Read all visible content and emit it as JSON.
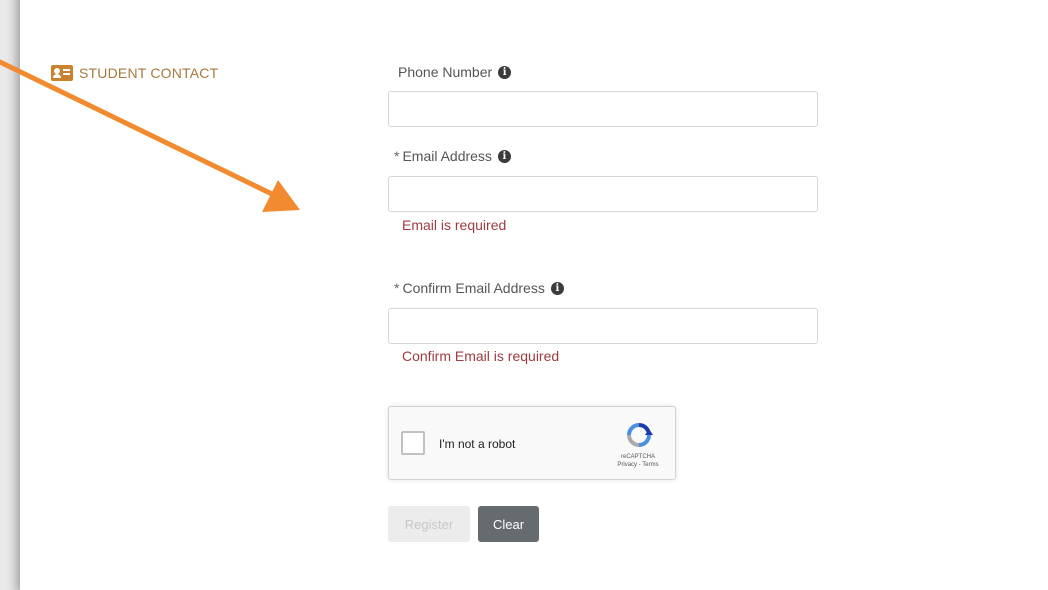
{
  "section": {
    "title": "STUDENT CONTACT",
    "icon": "contact-card-icon",
    "accent_color": "#c9822e"
  },
  "fields": {
    "phone": {
      "label": "Phone Number",
      "required": "",
      "value": "",
      "placeholder": ""
    },
    "email": {
      "label": "Email Address",
      "required": "*",
      "value": "",
      "placeholder": "",
      "error": "Email is required"
    },
    "confirm_email": {
      "label": "Confirm Email Address",
      "required": "*",
      "value": "",
      "placeholder": "",
      "error": "Confirm Email is required"
    }
  },
  "recaptcha": {
    "label": "I'm not a robot",
    "brand": "reCAPTCHA",
    "terms": "Privacy - Terms",
    "checked": false
  },
  "buttons": {
    "register_label": "Register",
    "clear_label": "Clear"
  },
  "info_icon": "info-icon",
  "colors": {
    "error": "#a03b42",
    "arrow": "#f28a30",
    "clear_button": "#666b70"
  }
}
